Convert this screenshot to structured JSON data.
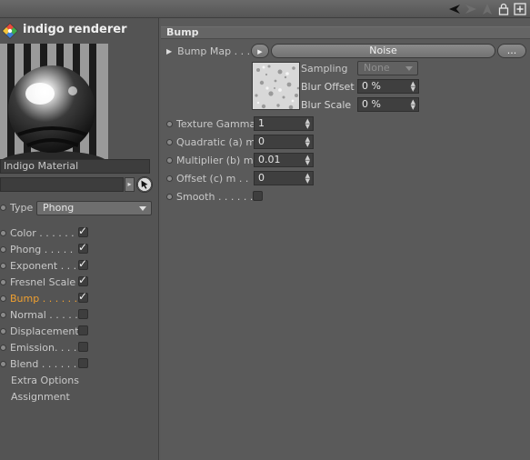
{
  "header": {
    "title": "indigo renderer"
  },
  "material": {
    "name": "Indigo Material",
    "link_value": ""
  },
  "type_select": {
    "label": "Type",
    "value": "Phong"
  },
  "channels": [
    {
      "label": "Color . . . . . .",
      "checked": true,
      "active": false
    },
    {
      "label": "Phong . . . . .",
      "checked": true,
      "active": false
    },
    {
      "label": "Exponent . . .",
      "checked": true,
      "active": false
    },
    {
      "label": "Fresnel Scale",
      "checked": true,
      "active": false
    },
    {
      "label": "Bump . . . . . .",
      "checked": true,
      "active": true
    },
    {
      "label": "Normal . . . . .",
      "checked": false,
      "active": false
    },
    {
      "label": "Displacement",
      "checked": false,
      "active": false
    },
    {
      "label": "Emission. . . .",
      "checked": false,
      "active": false
    },
    {
      "label": "Blend . . . . . .",
      "checked": false,
      "active": false
    }
  ],
  "extra": [
    "Extra Options",
    "Assignment"
  ],
  "bump": {
    "section_title": "Bump",
    "bump_map_label": "Bump Map . . . .",
    "shader_name": "Noise",
    "more_button": "...",
    "sampling_label": "Sampling",
    "sampling_value": "None",
    "blur_offset_label": "Blur Offset",
    "blur_offset_value": "0 %",
    "blur_scale_label": "Blur Scale",
    "blur_scale_value": "0 %",
    "params": [
      {
        "label": "Texture Gamma",
        "value": "1"
      },
      {
        "label": "Quadratic (a) m",
        "value": "0"
      },
      {
        "label": "Multiplier (b) m",
        "value": "0.01"
      },
      {
        "label": "Offset (c) m . .",
        "value": "0"
      }
    ],
    "smooth_label": "Smooth . . . . . .",
    "smooth_checked": false
  },
  "colors": {
    "active_label": "#f0a030",
    "background": "#595959"
  }
}
